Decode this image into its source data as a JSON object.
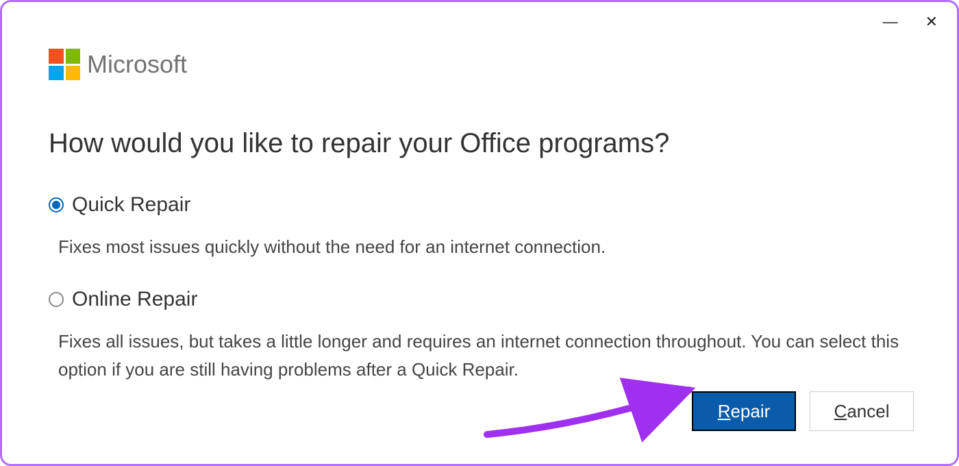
{
  "brand": "Microsoft",
  "heading": "How would you like to repair your Office programs?",
  "options": [
    {
      "label": "Quick Repair",
      "description": "Fixes most issues quickly without the need for an internet connection.",
      "selected": true
    },
    {
      "label": "Online Repair",
      "description": "Fixes all issues, but takes a little longer and requires an internet connection throughout. You can select this option if you are still having problems after a Quick Repair.",
      "selected": false
    }
  ],
  "buttons": {
    "repair_prefix": "R",
    "repair_rest": "epair",
    "cancel_prefix": "C",
    "cancel_rest": "ancel"
  },
  "colors": {
    "accent": "#0a5cab",
    "arrow": "#a030f0",
    "border": "#b06dff"
  }
}
